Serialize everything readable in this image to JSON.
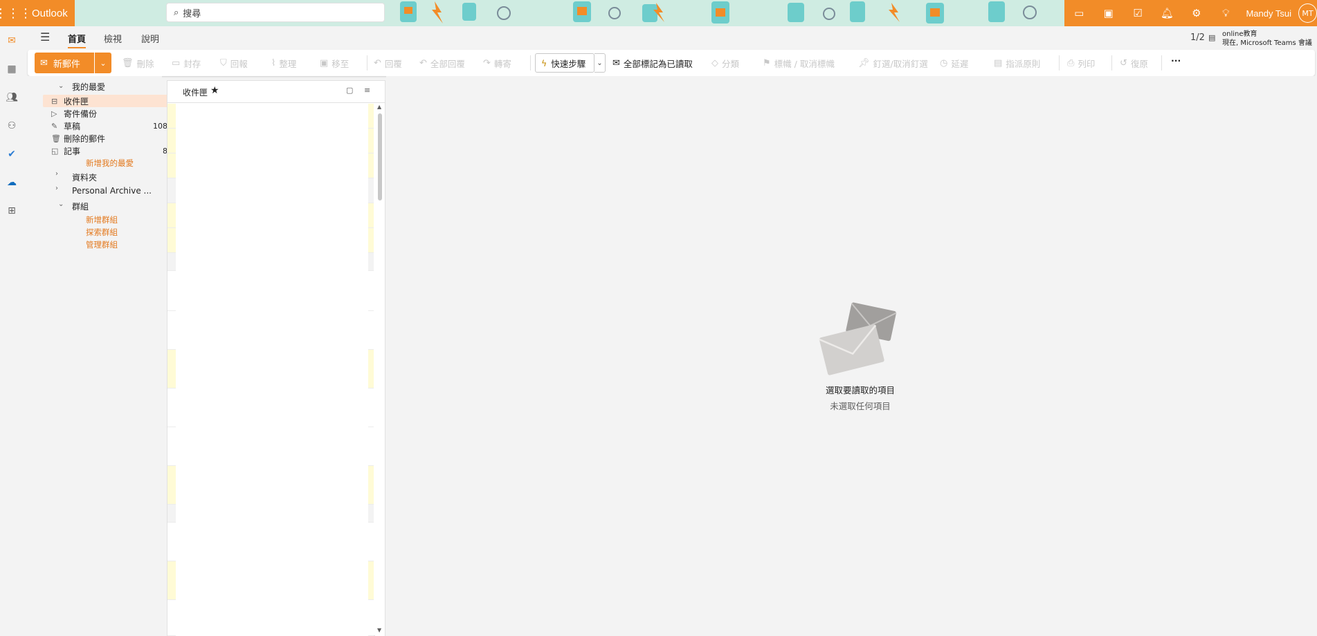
{
  "app": {
    "name": "Outlook"
  },
  "search": {
    "placeholder": "搜尋"
  },
  "user": {
    "name": "Mandy Tsui",
    "initials": "MT"
  },
  "tabs": [
    {
      "label": "首頁",
      "selected": true
    },
    {
      "label": "檢視",
      "selected": false
    },
    {
      "label": "說明",
      "selected": false
    }
  ],
  "meeting": {
    "count": "1/2",
    "title": "online教育",
    "subtitle": "現在, Microsoft Teams 會議"
  },
  "ribbon": {
    "new_mail": "新郵件",
    "delete": "刪除",
    "archive": "封存",
    "report": "回報",
    "sweep": "整理",
    "move_to": "移至",
    "reply": "回覆",
    "reply_all": "全部回覆",
    "forward": "轉寄",
    "quick_steps": "快速步驟",
    "mark_all_read": "全部標記為已讀取",
    "categorize": "分類",
    "flag": "標幟 / 取消標幟",
    "pin": "釘選/取消釘選",
    "snooze": "延遲",
    "rules": "指派原則",
    "print": "列印",
    "undo": "復原",
    "more": "···"
  },
  "folders": {
    "favorites_header": "我的最愛",
    "favorites": [
      {
        "label": "收件匣",
        "icon": "inbox-icon",
        "count": "",
        "selected": true
      },
      {
        "label": "寄件備份",
        "icon": "send-icon",
        "count": ""
      },
      {
        "label": "草稿",
        "icon": "draft-icon",
        "count": "108"
      },
      {
        "label": "刪除的郵件",
        "icon": "trash-icon",
        "count": ""
      },
      {
        "label": "記事",
        "icon": "note-icon",
        "count": "8"
      }
    ],
    "add_favorite": "新增我的最愛",
    "folders_header": "資料夾",
    "archive_header": "Personal Archive ...",
    "groups_header": "群組",
    "groups_links": [
      "新增群組",
      "探索群組",
      "管理群組"
    ]
  },
  "message_list": {
    "title": "收件匣"
  },
  "reading_pane": {
    "title": "選取要讀取的項目",
    "subtitle": "未選取任何項目"
  },
  "colors": {
    "accent": "#f28c28",
    "unread": "#fffbd6",
    "selected_folder": "#fde3d2"
  }
}
